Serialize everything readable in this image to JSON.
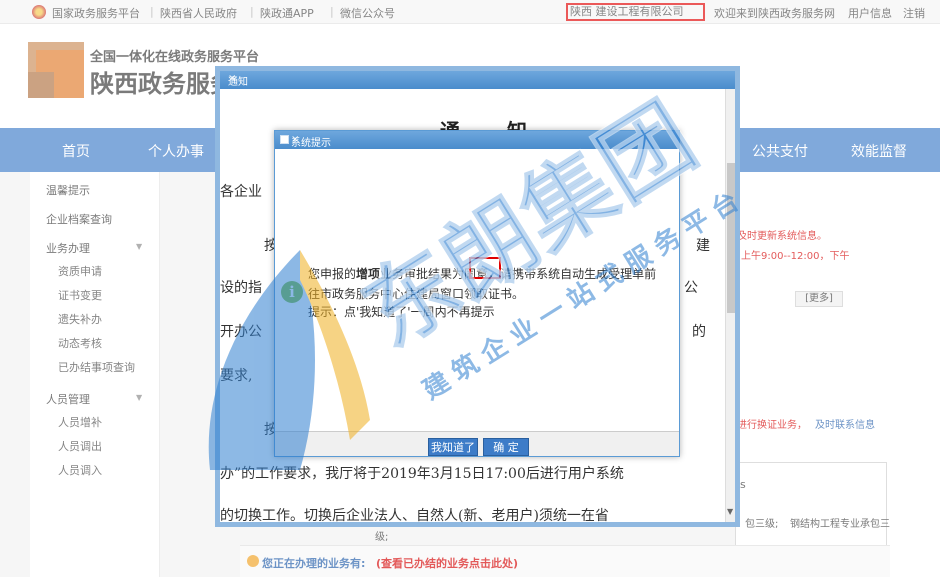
{
  "topbar": {
    "links": [
      "国家政务服务平台",
      "陕西省人民政府",
      "陕政通APP",
      "微信公众号"
    ],
    "company": "陕西        建设工程有限公司",
    "welcome": "欢迎来到陕西政务服务网",
    "user_info": "用户信息",
    "logout": "注销"
  },
  "header": {
    "slogan": "全国一体化在线政务服务平台",
    "site_name": "陕西政务服务网"
  },
  "nav": {
    "items": [
      "首页",
      "个人办事",
      "公共支付",
      "效能监督"
    ]
  },
  "sidebar": {
    "items": [
      "温馨提示",
      "企业档案查询",
      "业务办理",
      "资质申请",
      "证书变更",
      "遗失补办",
      "动态考核",
      "已办结事项查询",
      "人员管理",
      "人员增补",
      "人员调出",
      "人员调入"
    ]
  },
  "background": {
    "red_line1": "及时更新系统信息。",
    "red_line2": "上午9:00--12:00，下午",
    "more": "[更多]",
    "red_line3": "进行换证业务，",
    "blue_line3": "及时联系信息",
    "table_s": "s",
    "table_text1": "包三级;",
    "table_text2": "钢结构工程专业承包三",
    "table_text3": "级;",
    "ongoing": "您正在办理的业务有:",
    "ongoing_link": "(查看已办结的业务点击此处)"
  },
  "notice": {
    "window_title": "通知",
    "title": "通 知",
    "lines": [
      "各企业",
      "按",
      "建",
      "设的指",
      "公",
      "开办公",
      "的",
      "要求,",
      "按",
      "办”的工作要求，我厅将于2019年3月15日17:00后进行用户系统",
      "的切换工作。切换后企业法人、自然人(新、老用户)须统一在省"
    ]
  },
  "dialog": {
    "title": "系统提示",
    "line1_a": "您申报的",
    "line1_b": "增项",
    "line1_c": "业务审批结果为",
    "line1_d": "同意",
    "line1_e": "，请携带系统自动生成受理单前",
    "line2": "往市政务服务中心住建局窗口领取证书。",
    "line3": "提示：点'我知道了'一周内不再提示",
    "btn_know": "我知道了",
    "btn_ok": "确 定"
  },
  "watermark": {
    "main": "东朗集团",
    "sub": "建筑企业一站式服务平台"
  }
}
